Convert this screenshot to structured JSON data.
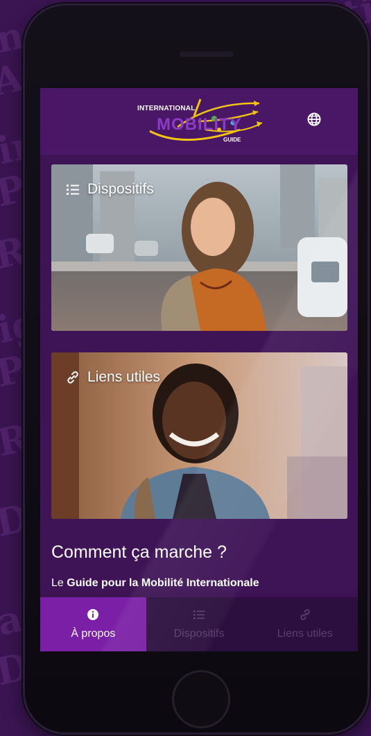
{
  "header": {
    "logo_top": "INTERNATIONAL",
    "logo_mid": "MOBILITY",
    "logo_bot": "GUIDE",
    "globe_icon": "globe-icon"
  },
  "cards": [
    {
      "label": "Dispositifs",
      "icon": "list-icon"
    },
    {
      "label": "Liens utiles",
      "icon": "link-icon"
    }
  ],
  "section": {
    "title": "Comment ça marche ?",
    "intro": "Le ",
    "bold": "Guide pour la Mobilité Internationale"
  },
  "nav": [
    {
      "label": "À propos",
      "icon": "info-icon",
      "active": true
    },
    {
      "label": "Dispositifs",
      "icon": "list-icon",
      "active": false
    },
    {
      "label": "Liens utiles",
      "icon": "link-icon",
      "active": false
    }
  ],
  "colors": {
    "accent": "#7a1fa6",
    "header": "#4a1766",
    "screen_bg": "#3f1457",
    "nav_bg": "#2c0f3e",
    "nav_inactive": "#5b3f6e"
  }
}
